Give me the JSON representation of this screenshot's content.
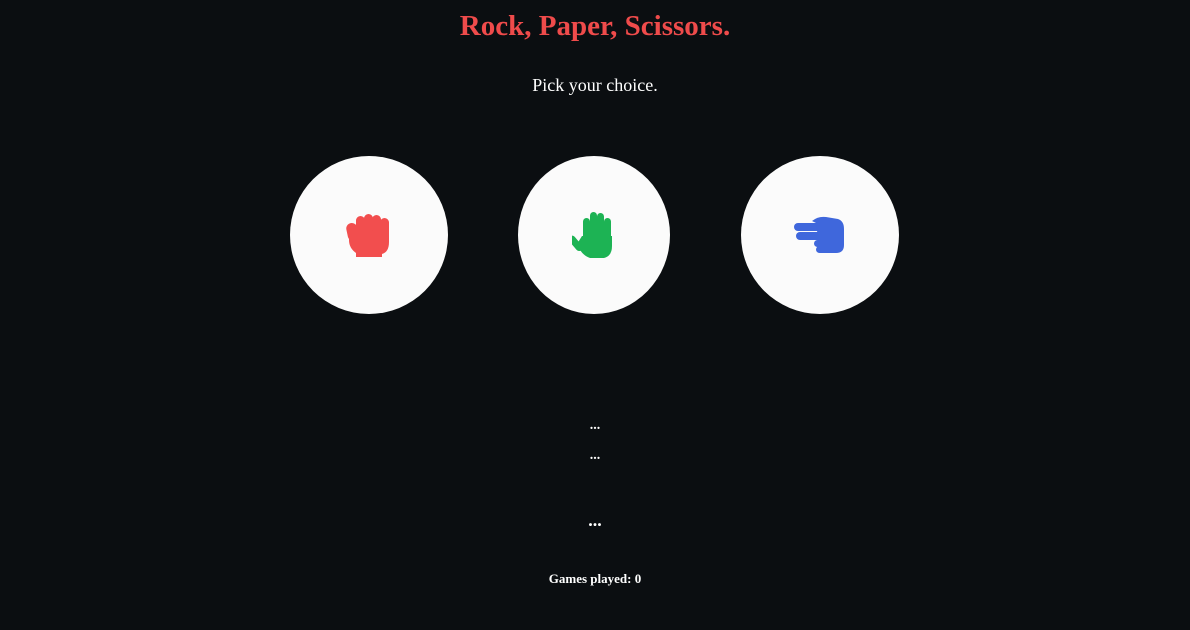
{
  "title": "Rock, Paper, Scissors.",
  "subtitle": "Pick your choice.",
  "colors": {
    "background": "#0b0e11",
    "title": "#ef4b4b",
    "rock": "#f24e4e",
    "paper": "#1db354",
    "scissors": "#3f67dc",
    "circle": "#fbfbfb",
    "text": "#ffffff"
  },
  "choices": [
    {
      "name": "rock",
      "icon": "fist-icon"
    },
    {
      "name": "paper",
      "icon": "open-hand-icon"
    },
    {
      "name": "scissors",
      "icon": "scissors-hand-icon"
    }
  ],
  "result": {
    "player_choice": "...",
    "computer_choice": "...",
    "outcome": "..."
  },
  "games_played": "Games played: 0"
}
